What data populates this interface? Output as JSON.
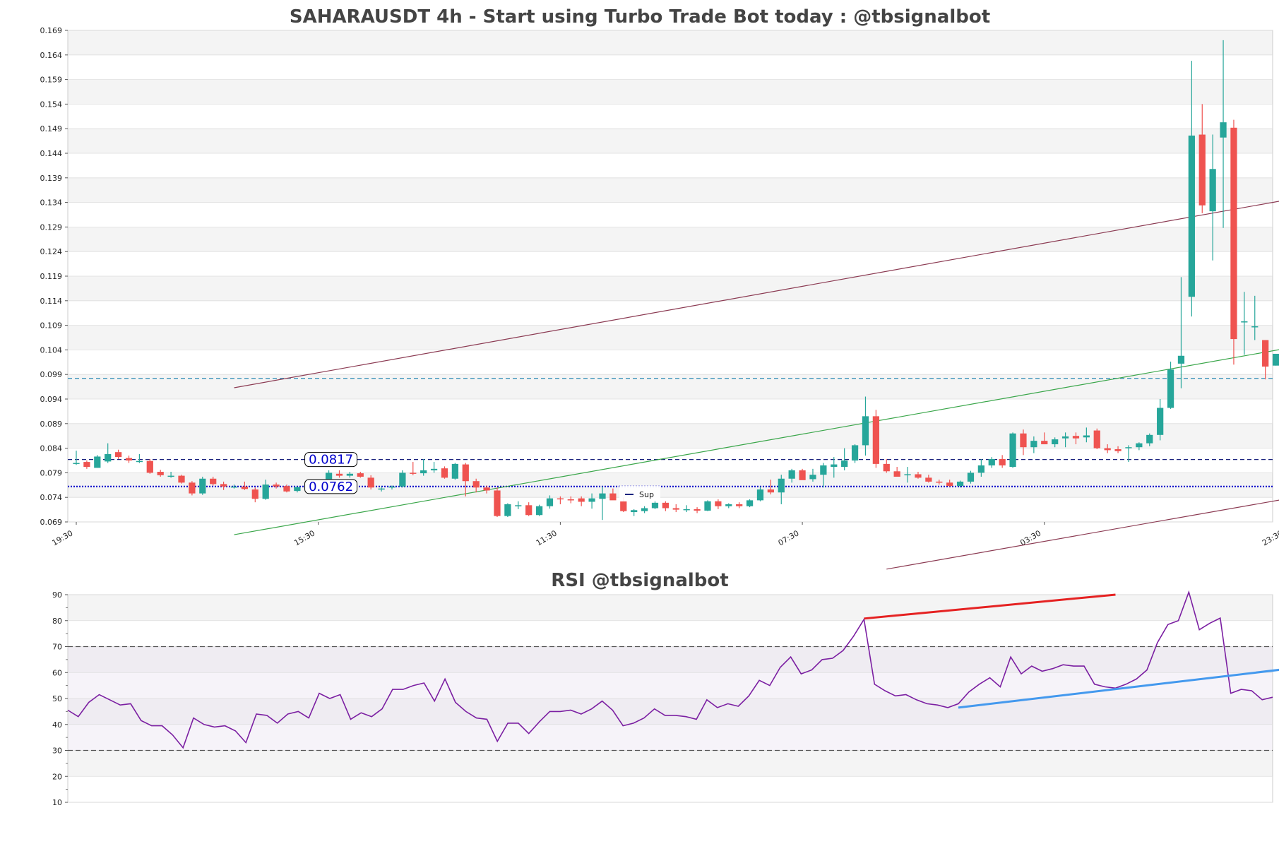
{
  "chart_data": [
    {
      "type": "candlestick",
      "title": "SAHARAUSDT 4h - Start using Turbo Trade Bot today : @tbsignalbot",
      "ylim": [
        0.069,
        0.169
      ],
      "yticks": [
        "0.069",
        "0.074",
        "0.079",
        "0.084",
        "0.089",
        "0.094",
        "0.099",
        "0.104",
        "0.109",
        "0.114",
        "0.119",
        "0.124",
        "0.129",
        "0.134",
        "0.139",
        "0.144",
        "0.149",
        "0.154",
        "0.159",
        "0.164",
        "0.169"
      ],
      "xticks": [
        {
          "index": 0,
          "label": "19:30"
        },
        {
          "index": 23,
          "label": "15:30"
        },
        {
          "index": 46,
          "label": "11:30"
        },
        {
          "index": 69,
          "label": "07:30"
        },
        {
          "index": 92,
          "label": "03:30"
        },
        {
          "index": 115,
          "label": "23:30"
        }
      ],
      "grid": true,
      "legend": {
        "position": "center",
        "entries": [
          "Sup"
        ]
      },
      "levels": [
        {
          "value": 0.0817,
          "label": "0.0817",
          "style": "dashed",
          "color": "#1a237e"
        },
        {
          "value": 0.0762,
          "label": "0.0762",
          "style": "dotted",
          "color": "#0000cc"
        },
        {
          "value": 0.0982,
          "label": "",
          "style": "dashed",
          "color": "#2e8bb5"
        }
      ],
      "trendlines": [
        {
          "from": [
            15,
            0.0963
          ],
          "to": [
            115,
            0.1345
          ],
          "color": "#8b3a52"
        },
        {
          "from": [
            15,
            0.0664
          ],
          "to": [
            115,
            0.1043
          ],
          "color": "#3aa64a"
        },
        {
          "from": [
            77,
            0.0594
          ],
          "to": [
            115,
            0.0737
          ],
          "color": "#8b3a52"
        }
      ],
      "candles": [
        [
          0.0808,
          0.0835,
          0.0806,
          0.081
        ],
        [
          0.0812,
          0.0815,
          0.0798,
          0.0802
        ],
        [
          0.08,
          0.0826,
          0.08,
          0.0823
        ],
        [
          0.0813,
          0.085,
          0.081,
          0.0828
        ],
        [
          0.0832,
          0.0837,
          0.0818,
          0.0822
        ],
        [
          0.082,
          0.0825,
          0.081,
          0.0815
        ],
        [
          0.0814,
          0.0828,
          0.081,
          0.0814
        ],
        [
          0.0814,
          0.0818,
          0.0788,
          0.079
        ],
        [
          0.0792,
          0.0796,
          0.0782,
          0.0785
        ],
        [
          0.0784,
          0.0792,
          0.078,
          0.0784
        ],
        [
          0.0784,
          0.0786,
          0.0768,
          0.077
        ],
        [
          0.077,
          0.0773,
          0.0744,
          0.0748
        ],
        [
          0.0748,
          0.0782,
          0.0745,
          0.0778
        ],
        [
          0.0778,
          0.0782,
          0.0764,
          0.0767
        ],
        [
          0.0767,
          0.0772,
          0.0755,
          0.0762
        ],
        [
          0.0762,
          0.0766,
          0.0758,
          0.0762
        ],
        [
          0.0762,
          0.0772,
          0.0755,
          0.0757
        ],
        [
          0.0756,
          0.076,
          0.073,
          0.0737
        ],
        [
          0.0737,
          0.0776,
          0.0735,
          0.0766
        ],
        [
          0.0766,
          0.077,
          0.0758,
          0.0762
        ],
        [
          0.0763,
          0.0766,
          0.075,
          0.0752
        ],
        [
          0.0753,
          0.0762,
          0.075,
          0.0761
        ],
        [
          0.076,
          0.0766,
          0.0756,
          0.0764
        ],
        [
          0.0764,
          0.0774,
          0.075,
          0.0754
        ],
        [
          0.0775,
          0.0795,
          0.077,
          0.079
        ],
        [
          0.0788,
          0.0795,
          0.078,
          0.0784
        ],
        [
          0.0784,
          0.0792,
          0.078,
          0.0788
        ],
        [
          0.0789,
          0.0792,
          0.078,
          0.0782
        ],
        [
          0.078,
          0.0785,
          0.0756,
          0.076
        ],
        [
          0.0757,
          0.0762,
          0.0752,
          0.0758
        ],
        [
          0.076,
          0.0764,
          0.0756,
          0.0762
        ],
        [
          0.0762,
          0.0795,
          0.076,
          0.079
        ],
        [
          0.079,
          0.0812,
          0.0785,
          0.0788
        ],
        [
          0.0789,
          0.0818,
          0.0784,
          0.0795
        ],
        [
          0.0795,
          0.0812,
          0.079,
          0.0798
        ],
        [
          0.0799,
          0.0803,
          0.0778,
          0.078
        ],
        [
          0.0778,
          0.081,
          0.0776,
          0.0808
        ],
        [
          0.0807,
          0.081,
          0.0742,
          0.0773
        ],
        [
          0.0773,
          0.0778,
          0.075,
          0.076
        ],
        [
          0.076,
          0.0764,
          0.0748,
          0.0754
        ],
        [
          0.0754,
          0.076,
          0.07,
          0.0702
        ],
        [
          0.0702,
          0.0728,
          0.07,
          0.0726
        ],
        [
          0.0724,
          0.0732,
          0.0716,
          0.0724
        ],
        [
          0.0724,
          0.073,
          0.0702,
          0.0704
        ],
        [
          0.0704,
          0.0725,
          0.0702,
          0.0722
        ],
        [
          0.0722,
          0.0744,
          0.0717,
          0.0738
        ],
        [
          0.0738,
          0.0742,
          0.0726,
          0.0736
        ],
        [
          0.0736,
          0.0742,
          0.0728,
          0.0735
        ],
        [
          0.0738,
          0.0742,
          0.0722,
          0.0731
        ],
        [
          0.0731,
          0.0748,
          0.0717,
          0.0738
        ],
        [
          0.0737,
          0.0762,
          0.0694,
          0.0748
        ],
        [
          0.0748,
          0.0758,
          0.0736,
          0.0734
        ],
        [
          0.0732,
          0.074,
          0.071,
          0.0712
        ],
        [
          0.071,
          0.0716,
          0.0702,
          0.0714
        ],
        [
          0.0712,
          0.0722,
          0.0708,
          0.0718
        ],
        [
          0.0718,
          0.0734,
          0.0716,
          0.0729
        ],
        [
          0.0729,
          0.0732,
          0.0712,
          0.0718
        ],
        [
          0.0718,
          0.0726,
          0.071,
          0.0715
        ],
        [
          0.0715,
          0.0724,
          0.071,
          0.0716
        ],
        [
          0.0716,
          0.072,
          0.0708,
          0.0713
        ],
        [
          0.0713,
          0.0734,
          0.0712,
          0.0732
        ],
        [
          0.0732,
          0.0736,
          0.0716,
          0.0722
        ],
        [
          0.0722,
          0.0728,
          0.0718,
          0.0726
        ],
        [
          0.0726,
          0.073,
          0.0718,
          0.0722
        ],
        [
          0.0722,
          0.0736,
          0.072,
          0.0734
        ],
        [
          0.0734,
          0.0762,
          0.0732,
          0.0756
        ],
        [
          0.0756,
          0.0776,
          0.0746,
          0.075
        ],
        [
          0.075,
          0.0786,
          0.0726,
          0.0778
        ],
        [
          0.0778,
          0.0798,
          0.077,
          0.0795
        ],
        [
          0.0795,
          0.0798,
          0.0778,
          0.0775
        ],
        [
          0.0777,
          0.0798,
          0.0772,
          0.0786
        ],
        [
          0.0786,
          0.081,
          0.076,
          0.0805
        ],
        [
          0.0802,
          0.0822,
          0.078,
          0.0807
        ],
        [
          0.0802,
          0.084,
          0.0795,
          0.0815
        ],
        [
          0.0815,
          0.0848,
          0.081,
          0.0846
        ],
        [
          0.0846,
          0.0945,
          0.0825,
          0.0905
        ],
        [
          0.0905,
          0.0918,
          0.08,
          0.0808
        ],
        [
          0.0808,
          0.0818,
          0.079,
          0.0793
        ],
        [
          0.0793,
          0.0802,
          0.0786,
          0.0782
        ],
        [
          0.0785,
          0.0802,
          0.077,
          0.0787
        ],
        [
          0.0787,
          0.0792,
          0.0778,
          0.078
        ],
        [
          0.078,
          0.0786,
          0.077,
          0.0772
        ],
        [
          0.0772,
          0.0776,
          0.0766,
          0.077
        ],
        [
          0.077,
          0.0776,
          0.0762,
          0.0763
        ],
        [
          0.0763,
          0.0774,
          0.076,
          0.0772
        ],
        [
          0.0772,
          0.0794,
          0.0768,
          0.079
        ],
        [
          0.079,
          0.0818,
          0.0782,
          0.0805
        ],
        [
          0.0805,
          0.0822,
          0.08,
          0.0818
        ],
        [
          0.0818,
          0.0826,
          0.08,
          0.0805
        ],
        [
          0.0802,
          0.0872,
          0.08,
          0.087
        ],
        [
          0.087,
          0.0878,
          0.0826,
          0.0842
        ],
        [
          0.0842,
          0.0864,
          0.083,
          0.0855
        ],
        [
          0.0855,
          0.0872,
          0.0848,
          0.0848
        ],
        [
          0.0848,
          0.0862,
          0.0842,
          0.0858
        ],
        [
          0.086,
          0.0872,
          0.0842,
          0.0864
        ],
        [
          0.0865,
          0.0872,
          0.0848,
          0.086
        ],
        [
          0.0862,
          0.0882,
          0.0852,
          0.0866
        ],
        [
          0.0876,
          0.088,
          0.0838,
          0.084
        ],
        [
          0.084,
          0.0848,
          0.083,
          0.0836
        ],
        [
          0.0838,
          0.0844,
          0.083,
          0.0834
        ],
        [
          0.084,
          0.0846,
          0.0812,
          0.0842
        ],
        [
          0.0842,
          0.0852,
          0.0836,
          0.085
        ],
        [
          0.085,
          0.087,
          0.0844,
          0.0867
        ],
        [
          0.0867,
          0.094,
          0.0856,
          0.0922
        ],
        [
          0.0922,
          0.1016,
          0.092,
          0.1
        ],
        [
          0.1012,
          0.1188,
          0.0962,
          0.1028
        ],
        [
          0.1148,
          0.1628,
          0.1108,
          0.1476
        ],
        [
          0.1478,
          0.154,
          0.1318,
          0.1334
        ],
        [
          0.1322,
          0.1478,
          0.1222,
          0.1408
        ],
        [
          0.1472,
          0.167,
          0.1288,
          0.1503
        ],
        [
          0.1492,
          0.1508,
          0.101,
          0.1062
        ],
        [
          0.1096,
          0.1158,
          0.103,
          0.1098
        ],
        [
          0.1088,
          0.115,
          0.106,
          0.1088
        ],
        [
          0.106,
          0.106,
          0.098,
          0.1006
        ],
        [
          0.1008,
          0.1032,
          0.1008,
          0.1032
        ]
      ]
    },
    {
      "type": "line",
      "title": "RSI @tbsignalbot",
      "ylim": [
        10,
        90
      ],
      "yticks": [
        "10",
        "20",
        "30",
        "40",
        "50",
        "60",
        "70",
        "80",
        "90"
      ],
      "grid": true,
      "reference_lines": [
        30,
        70
      ],
      "series": [
        {
          "values": [
            45.5,
            43,
            48.5,
            51.5,
            49.5,
            47.5,
            48,
            41.5,
            39.5,
            39.5,
            36,
            31,
            42.5,
            40,
            39,
            39.5,
            37.5,
            33,
            44,
            43.5,
            40.5,
            44,
            45,
            42.5,
            52,
            50,
            51.5,
            42,
            44.5,
            43,
            46,
            53.5,
            53.5,
            55,
            56,
            49,
            57.5,
            48.5,
            45,
            42.5,
            42,
            33.5,
            40.5,
            40.5,
            36.5,
            41,
            45,
            45,
            45.5,
            44,
            46,
            49,
            45.5,
            39.5,
            40.5,
            42.5,
            46,
            43.5,
            43.5,
            43,
            42,
            49.5,
            46.5,
            48,
            47,
            51,
            57,
            55,
            62,
            66,
            59.5,
            61,
            65,
            65.5,
            68.5,
            74,
            80.5,
            55.5,
            53,
            51,
            51.5,
            49.5,
            48,
            47.5,
            46.5,
            48,
            52.5,
            55.5,
            58,
            54.5,
            66,
            59.5,
            62.5,
            60.5,
            61.5,
            63,
            62.5,
            62.5,
            55.5,
            54.5,
            54,
            55.5,
            57.5,
            61,
            71.5,
            78.5,
            80,
            91,
            76.5,
            79,
            81,
            52,
            53.5,
            53,
            49.5,
            50.5
          ]
        }
      ],
      "trendlines": [
        {
          "from": [
            76,
            80.8
          ],
          "to": [
            100,
            90.0
          ],
          "color": "#e52222"
        },
        {
          "from": [
            85,
            46.5
          ],
          "to": [
            117,
            61.7
          ],
          "color": "#4499ee"
        }
      ]
    }
  ],
  "colors": {
    "up": "#26a69a",
    "down": "#ef5350",
    "rsi_line": "#7b1fa2",
    "band_light": "#f4f4f4",
    "grid_line": "#dddddd",
    "title": "#444444"
  }
}
